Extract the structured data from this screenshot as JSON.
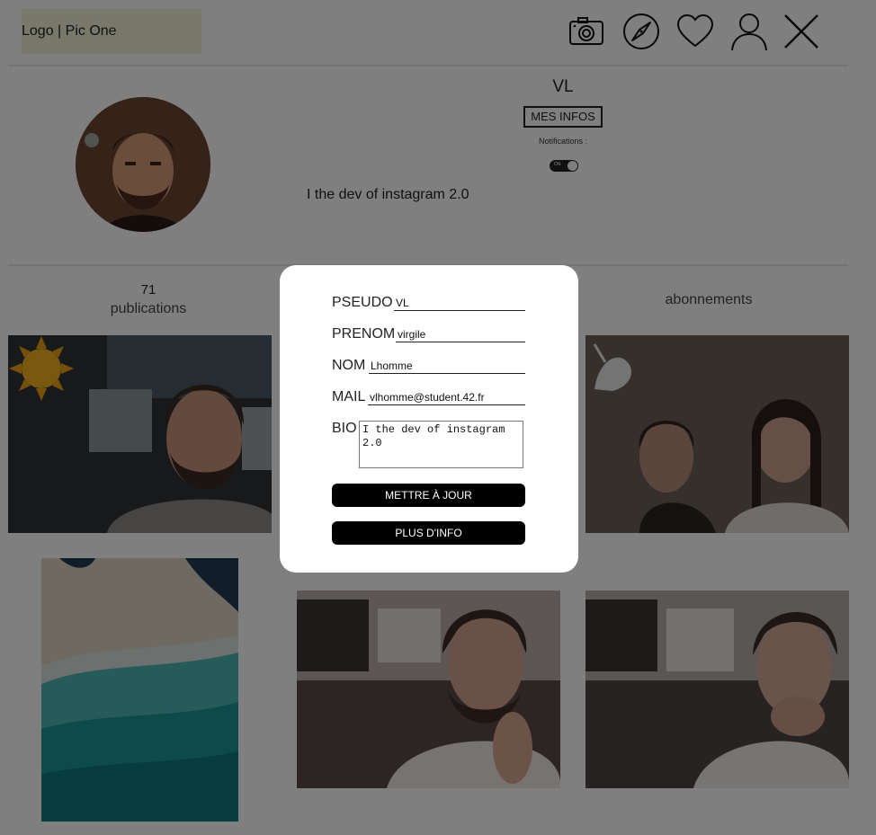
{
  "header": {
    "logo": "Logo | Pic One",
    "icons": [
      "camera-icon",
      "compass-icon",
      "heart-icon",
      "user-icon",
      "close-icon"
    ]
  },
  "profile": {
    "username": "VL",
    "info_button": "MES INFOS",
    "notifications_label": "Notifications :",
    "toggle_state": "ON",
    "bio": "I the dev of instagram 2.0",
    "publications_count": "71",
    "publications_label": "publications",
    "subscriptions_label": "abonnements"
  },
  "modal": {
    "fields": [
      {
        "label": "PSEUDO",
        "value": "VL"
      },
      {
        "label": "PRENOM",
        "value": "virgile"
      },
      {
        "label": "NOM",
        "value": "Lhomme"
      },
      {
        "label": "MAIL",
        "value": "vlhomme@student.42.fr"
      }
    ],
    "bio_label": "BIO",
    "bio_value": "I the dev of instagram 2.0",
    "update_button": "METTRE À JOUR",
    "more_button": "PLUS D'INFO"
  },
  "colors": {
    "overlay": "#000000",
    "button_bg": "#000000",
    "logo_bg": "#f0f0d6"
  }
}
